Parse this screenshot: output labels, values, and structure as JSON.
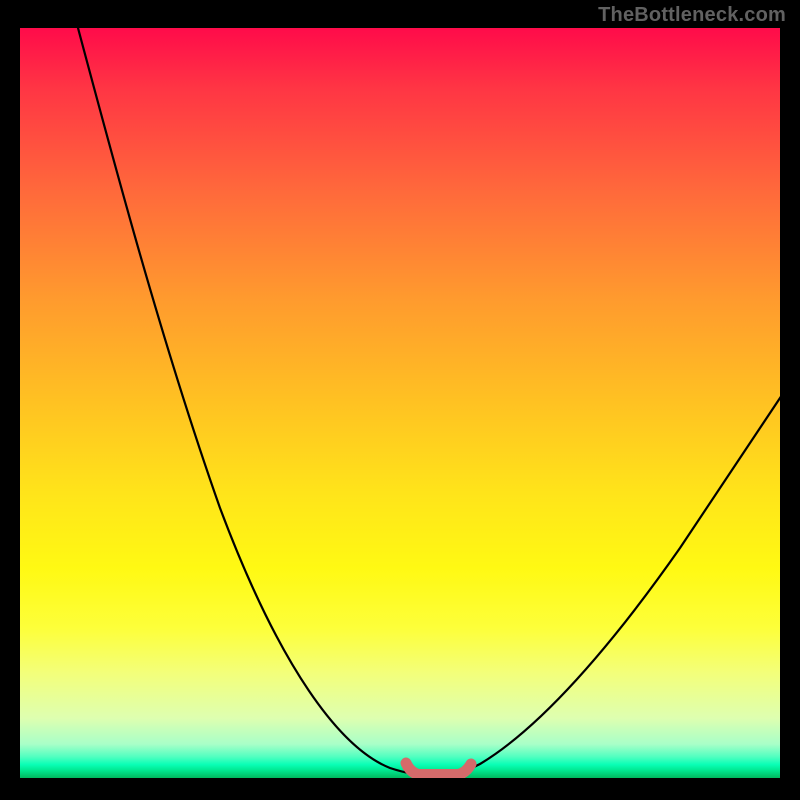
{
  "watermark": "TheBottleneck.com",
  "colors": {
    "background": "#000000",
    "curve": "#000000",
    "optimal_marker": "#d46a6a",
    "gradient_top": "#ff0b4a",
    "gradient_bottom": "#00b85e"
  },
  "chart_data": {
    "type": "line",
    "title": "",
    "xlabel": "",
    "ylabel": "",
    "xlim": [
      0,
      100
    ],
    "ylim": [
      0,
      100
    ],
    "grid": false,
    "legend": false,
    "series": [
      {
        "name": "bottleneck-curve",
        "x": [
          0,
          4,
          8,
          12,
          16,
          20,
          24,
          28,
          32,
          36,
          40,
          44,
          48,
          50,
          52,
          54,
          56,
          58,
          60,
          64,
          68,
          72,
          76,
          80,
          84,
          88,
          92,
          96,
          100
        ],
        "y": [
          110,
          100,
          89,
          78,
          67,
          57,
          47,
          38,
          29,
          21,
          14,
          8,
          3,
          1,
          0,
          0,
          0,
          0,
          1,
          4,
          9,
          15,
          22,
          29,
          36,
          43,
          49,
          55,
          60
        ]
      },
      {
        "name": "optimal-range",
        "x": [
          51,
          52,
          54,
          56,
          58,
          58.5
        ],
        "y": [
          1.6,
          0.5,
          0,
          0,
          0.4,
          1.4
        ]
      }
    ],
    "annotations": []
  }
}
